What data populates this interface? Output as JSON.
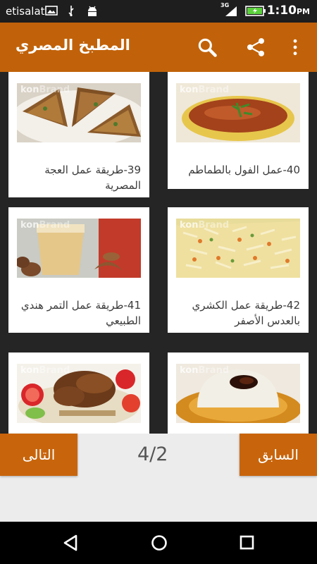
{
  "status_bar": {
    "carrier": "etisalat",
    "network": "3G",
    "time": "1:10",
    "ampm": "PM"
  },
  "app_bar": {
    "title": "المطبخ المصري",
    "search_icon": "search-icon",
    "share_icon": "share-icon",
    "menu_icon": "overflow-menu-icon"
  },
  "recipes": [
    {
      "label": "39-طريقة عمل العجة المصرية",
      "watermark_a": "kon",
      "watermark_b": "Brand",
      "image": "egg-omelette-slices"
    },
    {
      "label": "40-عمل الفول بالطماطم",
      "watermark_a": "kon",
      "watermark_b": "Brand",
      "image": "fava-beans-tomato"
    },
    {
      "label": "41-طريقة عمل التمر هندي الطبيعي",
      "watermark_a": "kon",
      "watermark_b": "Brand",
      "image": "tamarind-drink"
    },
    {
      "label": "42-طريقة عمل الكشري بالعدس الأصفر",
      "watermark_a": "kon",
      "watermark_b": "Brand",
      "image": "koshary-yellow-lentils"
    },
    {
      "label": "",
      "watermark_a": "kon",
      "watermark_b": "Brand",
      "image": "roasted-pigeon-rice"
    },
    {
      "label": "",
      "watermark_a": "kon",
      "watermark_b": "Brand",
      "image": "white-pudding-sauce"
    }
  ],
  "pager": {
    "next_label": "التالى",
    "prev_label": "السابق",
    "page": "4/2"
  },
  "colors": {
    "app_bar": "#c1620a",
    "button": "#c8650c",
    "grid_background": "#252525"
  }
}
